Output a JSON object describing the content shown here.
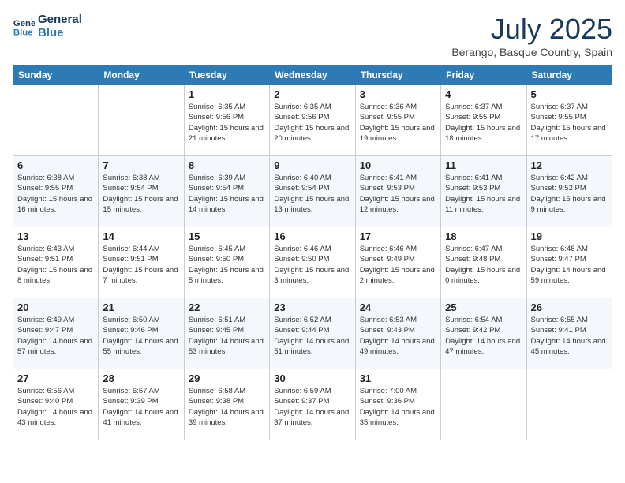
{
  "header": {
    "logo_line1": "General",
    "logo_line2": "Blue",
    "month": "July 2025",
    "location": "Berango, Basque Country, Spain"
  },
  "weekdays": [
    "Sunday",
    "Monday",
    "Tuesday",
    "Wednesday",
    "Thursday",
    "Friday",
    "Saturday"
  ],
  "weeks": [
    [
      {
        "day": "",
        "info": ""
      },
      {
        "day": "",
        "info": ""
      },
      {
        "day": "1",
        "info": "Sunrise: 6:35 AM\nSunset: 9:56 PM\nDaylight: 15 hours and 21 minutes."
      },
      {
        "day": "2",
        "info": "Sunrise: 6:35 AM\nSunset: 9:56 PM\nDaylight: 15 hours and 20 minutes."
      },
      {
        "day": "3",
        "info": "Sunrise: 6:36 AM\nSunset: 9:55 PM\nDaylight: 15 hours and 19 minutes."
      },
      {
        "day": "4",
        "info": "Sunrise: 6:37 AM\nSunset: 9:55 PM\nDaylight: 15 hours and 18 minutes."
      },
      {
        "day": "5",
        "info": "Sunrise: 6:37 AM\nSunset: 9:55 PM\nDaylight: 15 hours and 17 minutes."
      }
    ],
    [
      {
        "day": "6",
        "info": "Sunrise: 6:38 AM\nSunset: 9:55 PM\nDaylight: 15 hours and 16 minutes."
      },
      {
        "day": "7",
        "info": "Sunrise: 6:38 AM\nSunset: 9:54 PM\nDaylight: 15 hours and 15 minutes."
      },
      {
        "day": "8",
        "info": "Sunrise: 6:39 AM\nSunset: 9:54 PM\nDaylight: 15 hours and 14 minutes."
      },
      {
        "day": "9",
        "info": "Sunrise: 6:40 AM\nSunset: 9:54 PM\nDaylight: 15 hours and 13 minutes."
      },
      {
        "day": "10",
        "info": "Sunrise: 6:41 AM\nSunset: 9:53 PM\nDaylight: 15 hours and 12 minutes."
      },
      {
        "day": "11",
        "info": "Sunrise: 6:41 AM\nSunset: 9:53 PM\nDaylight: 15 hours and 11 minutes."
      },
      {
        "day": "12",
        "info": "Sunrise: 6:42 AM\nSunset: 9:52 PM\nDaylight: 15 hours and 9 minutes."
      }
    ],
    [
      {
        "day": "13",
        "info": "Sunrise: 6:43 AM\nSunset: 9:51 PM\nDaylight: 15 hours and 8 minutes."
      },
      {
        "day": "14",
        "info": "Sunrise: 6:44 AM\nSunset: 9:51 PM\nDaylight: 15 hours and 7 minutes."
      },
      {
        "day": "15",
        "info": "Sunrise: 6:45 AM\nSunset: 9:50 PM\nDaylight: 15 hours and 5 minutes."
      },
      {
        "day": "16",
        "info": "Sunrise: 6:46 AM\nSunset: 9:50 PM\nDaylight: 15 hours and 3 minutes."
      },
      {
        "day": "17",
        "info": "Sunrise: 6:46 AM\nSunset: 9:49 PM\nDaylight: 15 hours and 2 minutes."
      },
      {
        "day": "18",
        "info": "Sunrise: 6:47 AM\nSunset: 9:48 PM\nDaylight: 15 hours and 0 minutes."
      },
      {
        "day": "19",
        "info": "Sunrise: 6:48 AM\nSunset: 9:47 PM\nDaylight: 14 hours and 59 minutes."
      }
    ],
    [
      {
        "day": "20",
        "info": "Sunrise: 6:49 AM\nSunset: 9:47 PM\nDaylight: 14 hours and 57 minutes."
      },
      {
        "day": "21",
        "info": "Sunrise: 6:50 AM\nSunset: 9:46 PM\nDaylight: 14 hours and 55 minutes."
      },
      {
        "day": "22",
        "info": "Sunrise: 6:51 AM\nSunset: 9:45 PM\nDaylight: 14 hours and 53 minutes."
      },
      {
        "day": "23",
        "info": "Sunrise: 6:52 AM\nSunset: 9:44 PM\nDaylight: 14 hours and 51 minutes."
      },
      {
        "day": "24",
        "info": "Sunrise: 6:53 AM\nSunset: 9:43 PM\nDaylight: 14 hours and 49 minutes."
      },
      {
        "day": "25",
        "info": "Sunrise: 6:54 AM\nSunset: 9:42 PM\nDaylight: 14 hours and 47 minutes."
      },
      {
        "day": "26",
        "info": "Sunrise: 6:55 AM\nSunset: 9:41 PM\nDaylight: 14 hours and 45 minutes."
      }
    ],
    [
      {
        "day": "27",
        "info": "Sunrise: 6:56 AM\nSunset: 9:40 PM\nDaylight: 14 hours and 43 minutes."
      },
      {
        "day": "28",
        "info": "Sunrise: 6:57 AM\nSunset: 9:39 PM\nDaylight: 14 hours and 41 minutes."
      },
      {
        "day": "29",
        "info": "Sunrise: 6:58 AM\nSunset: 9:38 PM\nDaylight: 14 hours and 39 minutes."
      },
      {
        "day": "30",
        "info": "Sunrise: 6:59 AM\nSunset: 9:37 PM\nDaylight: 14 hours and 37 minutes."
      },
      {
        "day": "31",
        "info": "Sunrise: 7:00 AM\nSunset: 9:36 PM\nDaylight: 14 hours and 35 minutes."
      },
      {
        "day": "",
        "info": ""
      },
      {
        "day": "",
        "info": ""
      }
    ]
  ]
}
